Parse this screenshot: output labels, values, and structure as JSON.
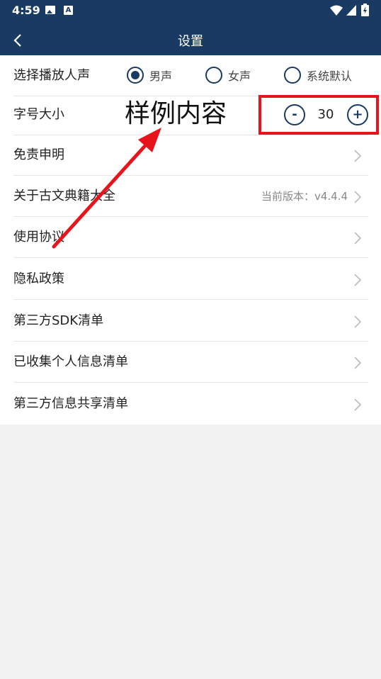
{
  "status_bar": {
    "time": "4:59",
    "icons": [
      "image-icon",
      "a-app-icon",
      "wifi-icon",
      "signal-icon",
      "battery-icon"
    ]
  },
  "header": {
    "title": "设置",
    "back_icon": "chevron-left-icon"
  },
  "voice": {
    "label": "选择播放人声",
    "options": [
      {
        "label": "男声",
        "checked": true
      },
      {
        "label": "女声",
        "checked": false
      },
      {
        "label": "系统默认",
        "checked": false
      }
    ]
  },
  "font_size": {
    "label": "字号大小",
    "sample_text": "样例内容",
    "minus": "-",
    "value": "30",
    "plus": "+"
  },
  "items": [
    {
      "label": "免责申明"
    },
    {
      "label": "关于古文典籍大全",
      "value": "当前版本：v4.4.4"
    },
    {
      "label": "使用协议"
    },
    {
      "label": "隐私政策"
    },
    {
      "label": "第三方SDK清单"
    },
    {
      "label": "已收集个人信息清单"
    },
    {
      "label": "第三方信息共享清单"
    }
  ],
  "colors": {
    "header": "#193a63",
    "accent": "#193a63",
    "annotation": "#e8141b",
    "background": "#f2f2f2"
  }
}
